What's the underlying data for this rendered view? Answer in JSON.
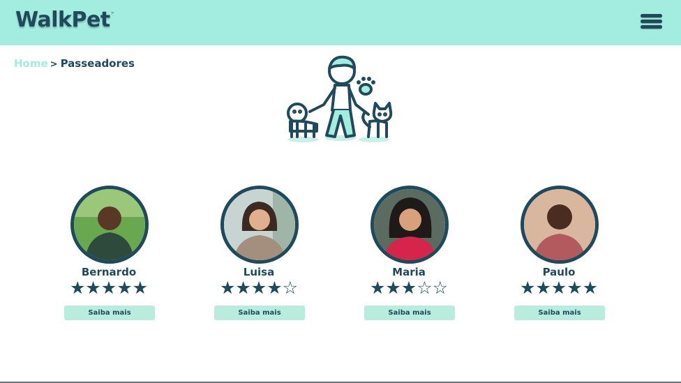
{
  "header": {
    "logo": "WalkPet",
    "logo_mark": "™",
    "menu_icon": "hamburger-menu-icon"
  },
  "breadcrumb": {
    "home": "Home",
    "separator": ">",
    "current": "Passeadores"
  },
  "hero": {
    "illustration": "person-walking-dog-and-cat"
  },
  "walkers": [
    {
      "name": "Bernardo",
      "rating": 5,
      "stars": "★★★★★",
      "button": "Saiba mais"
    },
    {
      "name": "Luisa",
      "rating": 4,
      "stars": "★★★★☆",
      "button": "Saiba mais"
    },
    {
      "name": "Maria",
      "rating": 3,
      "stars": "★★★☆☆",
      "button": "Saiba mais"
    },
    {
      "name": "Paulo",
      "rating": 5,
      "stars": "★★★★★",
      "button": "Saiba mais"
    }
  ],
  "colors": {
    "brand_mint": "#a3ece0",
    "brand_dark": "#1e4a5c",
    "button_bg": "#b8ecdc"
  }
}
